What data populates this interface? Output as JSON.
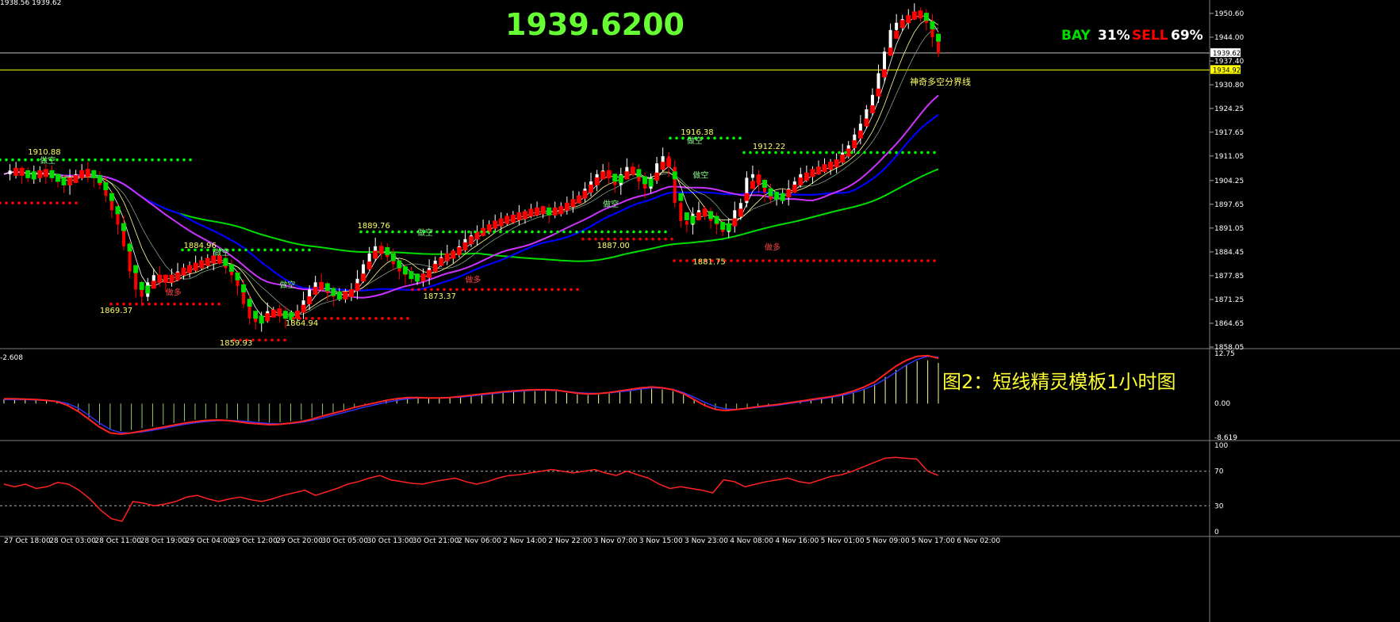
{
  "header": {
    "ohlc_text": "1938.56 1939.62",
    "big_price": "1939.6200",
    "bay_label": "BAY",
    "bay_value": "31%",
    "sell_label": "SELL",
    "sell_value": "69%"
  },
  "annotation_caption": "图2：短线精灵模板1小时图",
  "divider_label": "神奇多空分界线",
  "colors": {
    "bull": "#ffffff",
    "bear": "#ff0000",
    "ma_green": "#00dd00",
    "ma_blue": "#0000ff",
    "ma_magenta": "#cc33ff",
    "dot_green": "#00ff00",
    "dot_red": "#ff0000",
    "label_yellow": "#ffff66",
    "big_price": "#66ff33",
    "grid_line": "#c0c0c0",
    "divider_line": "#ffff00"
  },
  "chart_data": [
    {
      "type": "candlestick",
      "title": "1939.6200",
      "y_ticks": [
        "1950.60",
        "1944.00",
        "1937.40",
        "1930.80",
        "1924.25",
        "1917.65",
        "1911.05",
        "1904.25",
        "1897.65",
        "1891.05",
        "1884.45",
        "1877.85",
        "1871.25",
        "1864.65",
        "1858.05"
      ],
      "ylim": [
        1858.05,
        1953
      ],
      "current_price_tag": "1939.62",
      "divider_price_tag": "1934.92",
      "divider_price": 1934.92,
      "current_price": 1939.62,
      "x_ticks": [
        "27 Oct 18:00",
        "28 Oct 03:00",
        "28 Oct 11:00",
        "28 Oct 19:00",
        "29 Oct 04:00",
        "29 Oct 12:00",
        "29 Oct 20:00",
        "30 Oct 05:00",
        "30 Oct 13:00",
        "30 Oct 21:00",
        "2 Nov 06:00",
        "2 Nov 14:00",
        "2 Nov 22:00",
        "3 Nov 07:00",
        "3 Nov 15:00",
        "3 Nov 23:00",
        "4 Nov 08:00",
        "4 Nov 16:00",
        "5 Nov 01:00",
        "5 Nov 09:00",
        "5 Nov 17:00",
        "6 Nov 02:00"
      ],
      "close_path": [
        1906,
        1907,
        1907,
        1906,
        1905,
        1906,
        1907,
        1906,
        1905,
        1904,
        1903,
        1905,
        1906,
        1907,
        1906,
        1905,
        1903,
        1900,
        1896,
        1892,
        1886,
        1879,
        1874,
        1872,
        1876,
        1878,
        1877,
        1876,
        1878,
        1879,
        1880,
        1880,
        1881,
        1882,
        1882,
        1883,
        1882,
        1880,
        1878,
        1875,
        1870,
        1866,
        1865,
        1866,
        1868,
        1868,
        1867,
        1866,
        1867,
        1868,
        1871,
        1874,
        1876,
        1875,
        1873,
        1872,
        1872,
        1873,
        1874,
        1877,
        1881,
        1884,
        1886,
        1885,
        1883,
        1881,
        1879,
        1878,
        1877,
        1877,
        1878,
        1880,
        1882,
        1883,
        1884,
        1884,
        1886,
        1888,
        1889,
        1890,
        1891,
        1892,
        1893,
        1893,
        1894,
        1894,
        1895,
        1895,
        1896,
        1896,
        1896,
        1895,
        1896,
        1897,
        1898,
        1899,
        1900,
        1902,
        1904,
        1906,
        1907,
        1905,
        1903,
        1906,
        1908,
        1907,
        1904,
        1902,
        1905,
        1909,
        1911,
        1908,
        1898,
        1893,
        1892,
        1895,
        1896,
        1895,
        1893,
        1892,
        1890,
        1892,
        1896,
        1898,
        1905,
        1906,
        1903,
        1901,
        1899,
        1900,
        1900,
        1902,
        1904,
        1906,
        1906,
        1907,
        1908,
        1908,
        1909,
        1910,
        1912,
        1914,
        1917,
        1920,
        1924,
        1928,
        1934,
        1940,
        1946,
        1948,
        1949,
        1950,
        1951,
        1950,
        1948,
        1944,
        1939.6
      ],
      "sar_green": [
        {
          "from": 0,
          "to": 1910,
          "x1": 0,
          "x2": 240
        },
        {
          "from": 0,
          "to": 1885,
          "x1": 230,
          "x2": 395
        },
        {
          "from": 0,
          "to": 1890,
          "x1": 455,
          "x2": 840
        },
        {
          "from": 0,
          "to": 1916,
          "x1": 845,
          "x2": 935
        },
        {
          "from": 0,
          "to": 1912,
          "x1": 938,
          "x2": 1182
        }
      ],
      "sar_red": [
        {
          "level": 1898,
          "x1": 0,
          "x2": 100
        },
        {
          "level": 1870,
          "x1": 140,
          "x2": 280
        },
        {
          "level": 1860,
          "x1": 295,
          "x2": 365
        },
        {
          "level": 1866,
          "x1": 370,
          "x2": 520
        },
        {
          "level": 1874,
          "x1": 520,
          "x2": 728
        },
        {
          "level": 1888,
          "x1": 735,
          "x2": 850
        },
        {
          "level": 1882,
          "x1": 850,
          "x2": 1182
        }
      ],
      "annotations": [
        {
          "text": "1910.88",
          "price": 1911.5,
          "idx": 4
        },
        {
          "text": "做空",
          "price": 1909,
          "idx": 6
        },
        {
          "text": "1869.37",
          "price": 1867.5,
          "idx": 16
        },
        {
          "text": "做多",
          "price": 1872.5,
          "idx": 27
        },
        {
          "text": "1884.96",
          "price": 1885.5,
          "idx": 30
        },
        {
          "text": "做空",
          "price": 1883.5,
          "idx": 35
        },
        {
          "text": "1859.93",
          "price": 1858.5,
          "idx": 36
        },
        {
          "text": "1864.94",
          "price": 1864,
          "idx": 47
        },
        {
          "text": "做空",
          "price": 1874.5,
          "idx": 46
        },
        {
          "text": "1889.76",
          "price": 1891,
          "idx": 59
        },
        {
          "text": "做空",
          "price": 1889,
          "idx": 69
        },
        {
          "text": "1873.37",
          "price": 1871.5,
          "idx": 70
        },
        {
          "text": "做多",
          "price": 1876,
          "idx": 77
        },
        {
          "text": "1887.00",
          "price": 1885.5,
          "idx": 99
        },
        {
          "text": "做空",
          "price": 1897,
          "idx": 100
        },
        {
          "text": "1916.38",
          "price": 1917,
          "idx": 113
        },
        {
          "text": "做空",
          "price": 1914.5,
          "idx": 114
        },
        {
          "text": "做空",
          "price": 1905,
          "idx": 115
        },
        {
          "text": "1881.75",
          "price": 1881,
          "idx": 115
        },
        {
          "text": "1912.22",
          "price": 1913,
          "idx": 125
        },
        {
          "text": "做多",
          "price": 1885,
          "idx": 127
        }
      ]
    },
    {
      "type": "line",
      "title": "-2.608",
      "y_ticks": [
        "12.75",
        "0.00",
        "-8.619"
      ],
      "ylim": [
        -8.619,
        12.75
      ],
      "series_main": [
        1.2,
        1.2,
        1.1,
        1.0,
        0.8,
        0.5,
        -0.5,
        -2,
        -4,
        -6,
        -7.5,
        -7.8,
        -7.5,
        -7,
        -6.5,
        -6,
        -5.5,
        -5,
        -4.6,
        -4.3,
        -4.2,
        -4.3,
        -4.6,
        -5,
        -5.2,
        -5.4,
        -5.3,
        -5,
        -4.6,
        -4.0,
        -3.2,
        -2.5,
        -1.8,
        -1.0,
        -0.4,
        0.2,
        0.8,
        1.2,
        1.5,
        1.5,
        1.4,
        1.4,
        1.5,
        1.8,
        2.1,
        2.4,
        2.7,
        3.0,
        3.2,
        3.4,
        3.5,
        3.5,
        3.4,
        3.0,
        2.6,
        2.4,
        2.5,
        2.8,
        3.2,
        3.6,
        4.0,
        4.2,
        4.0,
        3.5,
        2.5,
        1.0,
        -0.5,
        -1.5,
        -1.8,
        -1.5,
        -1.2,
        -0.8,
        -0.5,
        -0.2,
        0.2,
        0.6,
        1.0,
        1.4,
        1.8,
        2.4,
        3.2,
        4.2,
        5.5,
        7.5,
        9.5,
        11,
        12,
        12.2,
        11.5
      ],
      "series_signal": [
        1.0,
        1.0,
        1.0,
        0.9,
        0.8,
        0.6,
        0.0,
        -1.2,
        -3,
        -5,
        -6.6,
        -7.4,
        -7.5,
        -7.2,
        -6.8,
        -6.3,
        -5.8,
        -5.3,
        -4.9,
        -4.6,
        -4.4,
        -4.3,
        -4.4,
        -4.6,
        -4.9,
        -5.1,
        -5.2,
        -5.1,
        -4.8,
        -4.3,
        -3.7,
        -3.0,
        -2.3,
        -1.6,
        -0.9,
        -0.3,
        0.3,
        0.8,
        1.2,
        1.4,
        1.4,
        1.4,
        1.5,
        1.6,
        1.9,
        2.2,
        2.5,
        2.8,
        3.0,
        3.2,
        3.4,
        3.4,
        3.3,
        3.1,
        2.8,
        2.6,
        2.6,
        2.7,
        3.0,
        3.3,
        3.7,
        4.0,
        3.9,
        3.6,
        2.8,
        1.6,
        0.3,
        -0.8,
        -1.4,
        -1.5,
        -1.3,
        -1.0,
        -0.7,
        -0.4,
        0.0,
        0.4,
        0.8,
        1.2,
        1.6,
        2.1,
        2.8,
        3.6,
        4.7,
        6.2,
        8.0,
        9.8,
        11.2,
        12.0,
        11.8
      ]
    },
    {
      "type": "line",
      "y_ticks": [
        "100",
        "70",
        "30",
        "0"
      ],
      "ylim": [
        0,
        100
      ],
      "levels": [
        70,
        30
      ],
      "series": [
        55,
        52,
        55,
        50,
        52,
        57,
        55,
        48,
        38,
        25,
        15,
        12,
        35,
        33,
        30,
        32,
        35,
        40,
        42,
        38,
        35,
        38,
        40,
        37,
        35,
        38,
        42,
        45,
        48,
        42,
        46,
        50,
        55,
        58,
        62,
        65,
        60,
        58,
        56,
        55,
        58,
        60,
        62,
        58,
        55,
        58,
        62,
        65,
        66,
        68,
        70,
        72,
        70,
        68,
        70,
        72,
        68,
        65,
        70,
        66,
        62,
        55,
        50,
        52,
        50,
        48,
        45,
        60,
        58,
        52,
        55,
        58,
        60,
        62,
        58,
        56,
        60,
        64,
        66,
        70,
        75,
        80,
        85,
        86,
        85,
        84,
        70,
        65
      ]
    }
  ]
}
